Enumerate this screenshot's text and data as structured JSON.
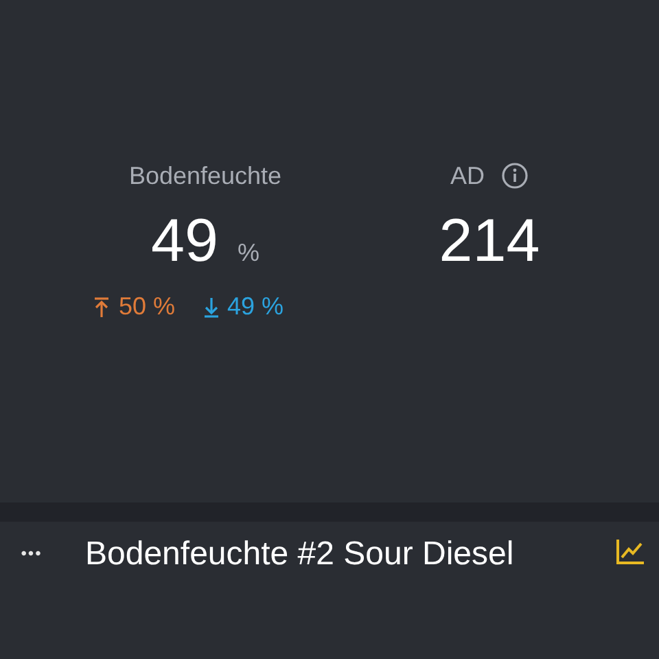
{
  "metrics": [
    {
      "label": "Bodenfeuchte",
      "value": "49",
      "unit": "%",
      "info": false,
      "max": "50 %",
      "min": "49 %"
    },
    {
      "label": "AD",
      "value": "214",
      "info": true
    }
  ],
  "footer": {
    "menu": "•••",
    "title": "Bodenfeuchte #2 Sour Diesel"
  }
}
